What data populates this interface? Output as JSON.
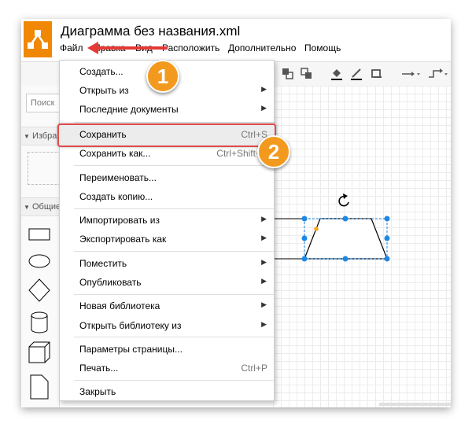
{
  "app": {
    "title": "Диаграмма без названия.xml",
    "accent_color": "#f08705",
    "highlight_color": "#e14b4b"
  },
  "menubar": [
    "Файл",
    "Правка",
    "Вид",
    "Расположить",
    "Дополнительно",
    "Помощь"
  ],
  "sidebar": {
    "search_placeholder": "Поиск",
    "favorites_label": "Избранное",
    "general_label": "Общие"
  },
  "file_menu": {
    "create": "Создать...",
    "open_from": "Открыть из",
    "recent": "Последние документы",
    "save": "Сохранить",
    "save_shortcut": "Ctrl+S",
    "save_as": "Сохранить как...",
    "save_as_shortcut": "Ctrl+Shift+S",
    "rename": "Переименовать...",
    "copy": "Создать копию...",
    "import_from": "Импортировать из",
    "export_as": "Экспортировать как",
    "embed": "Поместить",
    "publish": "Опубликовать",
    "new_library": "Новая библиотека",
    "open_library": "Открыть библиотеку из",
    "page_setup": "Параметры страницы...",
    "print": "Печать...",
    "print_shortcut": "Ctrl+P",
    "close": "Закрыть"
  },
  "annotations": {
    "step1": "1",
    "step2": "2"
  }
}
